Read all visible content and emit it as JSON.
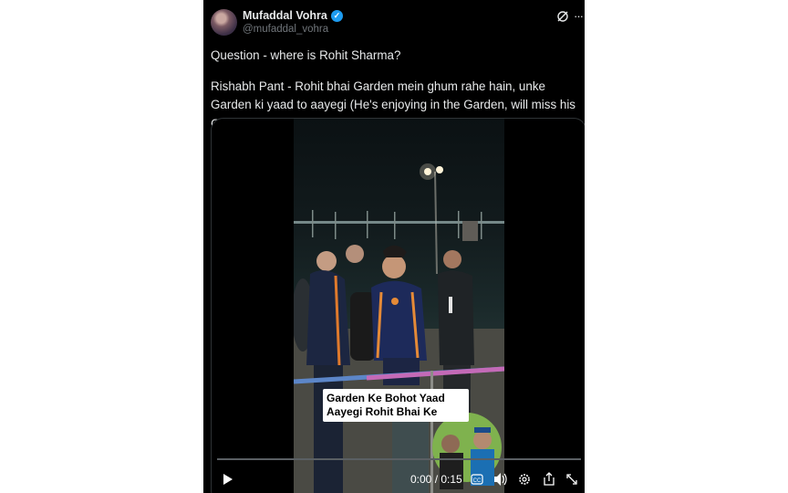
{
  "author": {
    "display_name": "Mufaddal Vohra",
    "handle": "@mufaddal_vohra",
    "verified_icon": "verified-badge-icon"
  },
  "post": {
    "line1": "Question - where is Rohit Sharma?",
    "line2": "Rishabh Pant - Rohit bhai Garden mein ghum rahe hain, unke Garden ki yaad to aayegi (He's enjoying in the Garden, will miss his Garden).",
    "emoji_laugh": "😂",
    "emoji_heart": "❤"
  },
  "video": {
    "caption_line1": "Garden Ke Bohot Yaad",
    "caption_line2": "Aayegi Rohit Bhai Ke",
    "time": "0:00 / 0:15",
    "progress": 0.0
  },
  "icons": {
    "grok": "grok-icon",
    "more": "more-icon",
    "play": "play-icon",
    "captions": "cc-icon",
    "volume": "volume-icon",
    "settings": "gear-icon",
    "share": "share-icon",
    "fullscreen": "fullscreen-icon"
  },
  "colors": {
    "background": "#000000",
    "text": "#e7e9ea",
    "muted": "#71767b",
    "verified": "#1d9bf0"
  }
}
